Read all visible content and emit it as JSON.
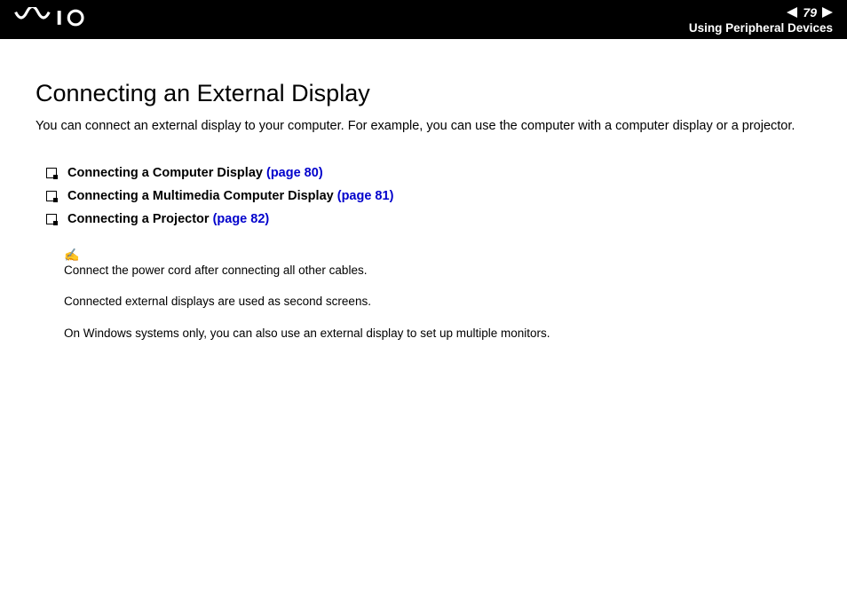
{
  "header": {
    "logo_alt": "VAIO",
    "page_number": "79",
    "section": "Using Peripheral Devices"
  },
  "main": {
    "title": "Connecting an External Display",
    "intro": "You can connect an external display to your computer. For example, you can use the computer with a computer display or a projector.",
    "links": [
      {
        "label": "Connecting a Computer Display ",
        "page": "(page 80)"
      },
      {
        "label": "Connecting a Multimedia Computer Display ",
        "page": "(page 81)"
      },
      {
        "label": "Connecting a Projector ",
        "page": "(page 82)"
      }
    ],
    "note_icon": "✍",
    "notes": [
      "Connect the power cord after connecting all other cables.",
      "Connected external displays are used as second screens.",
      "On Windows systems only, you can also use an external display to set up multiple monitors."
    ]
  }
}
